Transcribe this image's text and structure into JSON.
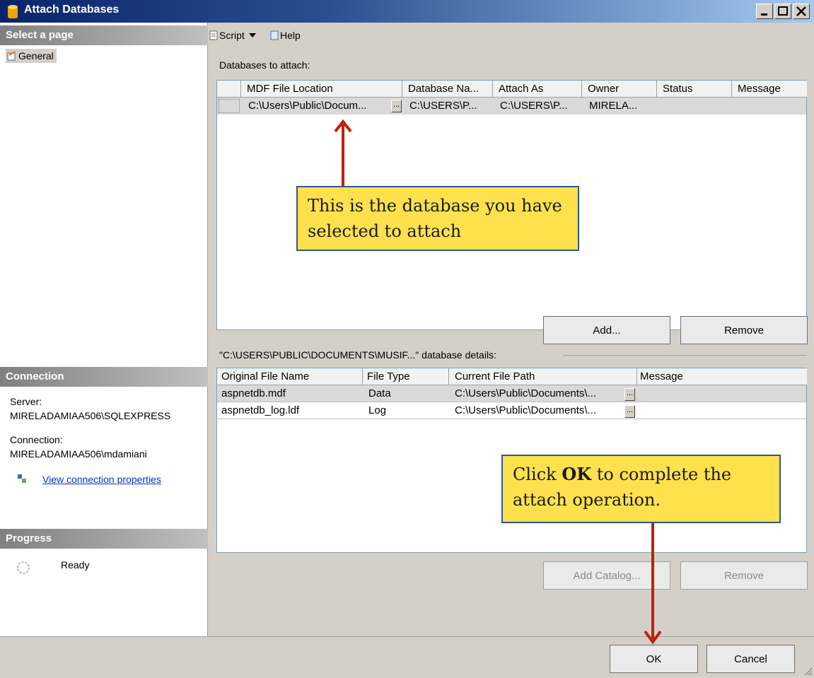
{
  "window": {
    "title": "Attach Databases"
  },
  "left": {
    "select_page_header": "Select a page",
    "pages": [
      {
        "label": "General"
      }
    ],
    "connection_header": "Connection",
    "server_label": "Server:",
    "server_value": "MIRELADAMIAA506\\SQLEXPRESS",
    "connection_label": "Connection:",
    "connection_value": "MIRELADAMIAA506\\mdamiani",
    "view_props_link": "View connection properties",
    "progress_header": "Progress",
    "progress_status": "Ready"
  },
  "toolbar": {
    "script_label": "Script",
    "help_label": "Help"
  },
  "attach": {
    "section_label": "Databases to attach:",
    "columns": [
      "MDF File Location",
      "Database Na...",
      "Attach As",
      "Owner",
      "Status",
      "Message"
    ],
    "rows": [
      {
        "mdf": "C:\\Users\\Public\\Docum...",
        "ellipsis": "...",
        "dbname": "C:\\USERS\\P...",
        "attach_as": "C:\\USERS\\P...",
        "owner": "MIRELA...",
        "status": "",
        "message": ""
      }
    ],
    "add_button": "Add...",
    "remove_button": "Remove"
  },
  "details": {
    "section_label": "\"C:\\USERS\\PUBLIC\\DOCUMENTS\\MUSIF...\" database details:",
    "columns": [
      "Original File Name",
      "File Type",
      "Current File Path",
      "Message"
    ],
    "rows": [
      {
        "name": "aspnetdb.mdf",
        "type": "Data",
        "path": "C:\\Users\\Public\\Documents\\...",
        "ellipsis": "...",
        "message": ""
      },
      {
        "name": "aspnetdb_log.ldf",
        "type": "Log",
        "path": "C:\\Users\\Public\\Documents\\...",
        "ellipsis": "...",
        "message": ""
      }
    ],
    "add_catalog_button": "Add Catalog...",
    "remove_button": "Remove"
  },
  "footer": {
    "ok_button": "OK",
    "cancel_button": "Cancel"
  },
  "callouts": {
    "top": "This is the database you have selected to attach",
    "bottom_prefix": "Click ",
    "bottom_bold": "OK",
    "bottom_suffix": " to complete the attach operation."
  },
  "colors": {
    "callout_fill": "#ffe14d",
    "callout_border": "#2f5597",
    "arrow": "#c0200a",
    "title_bar": "#0a246a"
  },
  "icons": [
    "database-icon",
    "minimize-icon",
    "maximize-icon",
    "close-icon",
    "script-icon",
    "help-icon",
    "page-icon",
    "connection-properties-icon",
    "progress-spinner-icon"
  ]
}
